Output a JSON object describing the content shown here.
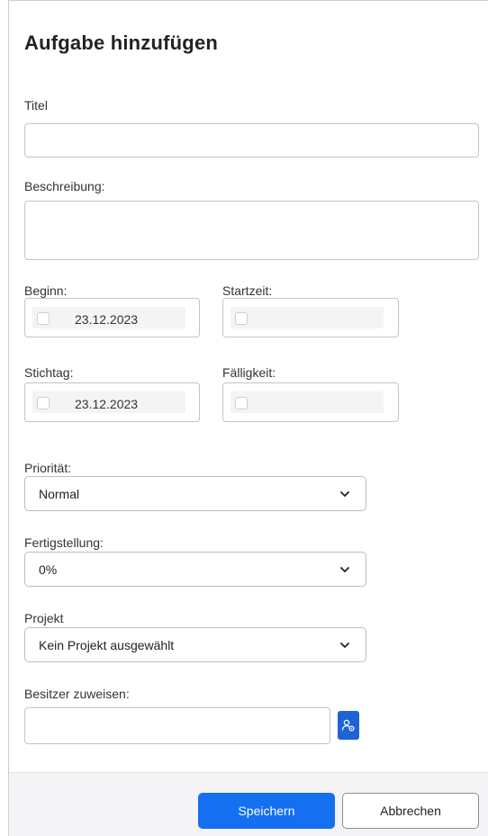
{
  "dialog": {
    "title": "Aufgabe hinzufügen"
  },
  "form": {
    "title_label": "Titel",
    "title_value": "",
    "description_label": "Beschreibung:",
    "description_value": "",
    "start_label": "Beginn:",
    "start_date": "23.12.2023",
    "start_time_label": "Startzeit:",
    "start_time": "",
    "deadline_label": "Stichtag:",
    "deadline_date": "23.12.2023",
    "due_label": "Fälligkeit:",
    "due_time": "",
    "priority_label": "Priorität:",
    "priority_value": "Normal",
    "completion_label": "Fertigstellung:",
    "completion_value": "0%",
    "project_label": "Projekt",
    "project_value": "Kein Projekt ausgewählt",
    "owner_label": "Besitzer zuweisen:",
    "owner_value": ""
  },
  "footer": {
    "save_label": "Speichern",
    "cancel_label": "Abbrechen"
  },
  "colors": {
    "primary": "#1470f0",
    "assign_button": "#1e63d6"
  },
  "icons": {
    "chevron": "chevron-down-icon",
    "assign": "person-settings-icon"
  }
}
